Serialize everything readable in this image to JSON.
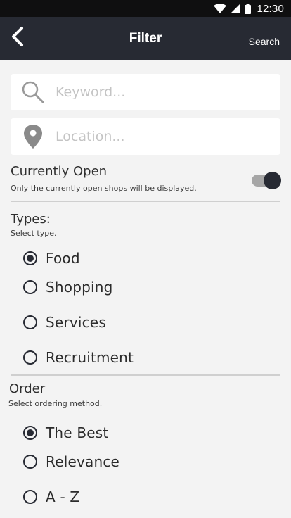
{
  "statusbar": {
    "time": "12:30"
  },
  "appbar": {
    "title": "Filter",
    "search_label": "Search"
  },
  "keyword": {
    "placeholder": "Keyword..."
  },
  "location": {
    "placeholder": "Location..."
  },
  "currently_open": {
    "title": "Currently Open",
    "description": "Only the currently open shops will be displayed.",
    "enabled": true
  },
  "types": {
    "title": "Types:",
    "subtitle": "Select type.",
    "options": [
      "Food",
      "Shopping",
      "Services",
      "Recruitment"
    ],
    "selected": "Food"
  },
  "order": {
    "title": "Order",
    "subtitle": "Select ordering method.",
    "options": [
      "The Best",
      "Relevance",
      "A - Z"
    ],
    "selected": "The Best"
  },
  "colors": {
    "appbar": "#272a33",
    "background": "#f3f3f3",
    "accent": "#272a33"
  }
}
